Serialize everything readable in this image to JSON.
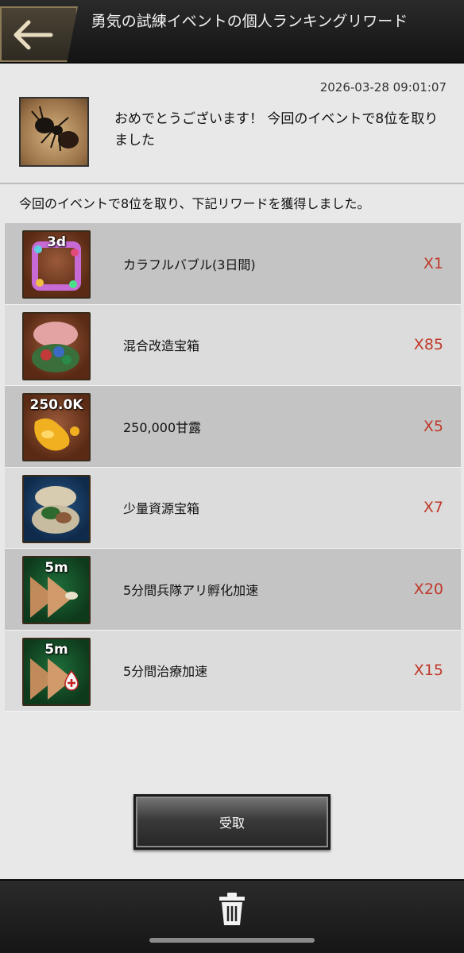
{
  "header": {
    "title": "勇気の試練イベントの個人ランキングリワード"
  },
  "message": {
    "timestamp": "2026-03-28 09:01:07",
    "text": "おめでとうございます！ 今回のイベントで8位を取りました",
    "subtext": "今回のイベントで8位を取り、下記リワードを獲得しました。"
  },
  "rewards": [
    {
      "name": "カラフルバブル(3日間)",
      "qty": "X1",
      "badge": "3d",
      "icon": "colorful-bubble-icon"
    },
    {
      "name": "混合改造宝箱",
      "qty": "X85",
      "badge": "",
      "icon": "mixed-mod-chest-icon"
    },
    {
      "name": "250,000甘露",
      "qty": "X5",
      "badge": "250.0K",
      "icon": "honeydew-icon"
    },
    {
      "name": "少量資源宝箱",
      "qty": "X7",
      "badge": "",
      "icon": "small-resource-chest-icon"
    },
    {
      "name": "5分間兵隊アリ孵化加速",
      "qty": "X20",
      "badge": "5m",
      "icon": "hatch-speedup-icon"
    },
    {
      "name": "5分間治療加速",
      "qty": "X15",
      "badge": "5m",
      "icon": "heal-speedup-icon"
    }
  ],
  "buttons": {
    "receive": "受取"
  },
  "icons": {
    "back": "back-arrow-icon",
    "trash": "trash-icon",
    "avatar": "ant-avatar-icon"
  },
  "colors": {
    "quantity": "#c0392b",
    "header_bg": "#1e1e1e"
  }
}
